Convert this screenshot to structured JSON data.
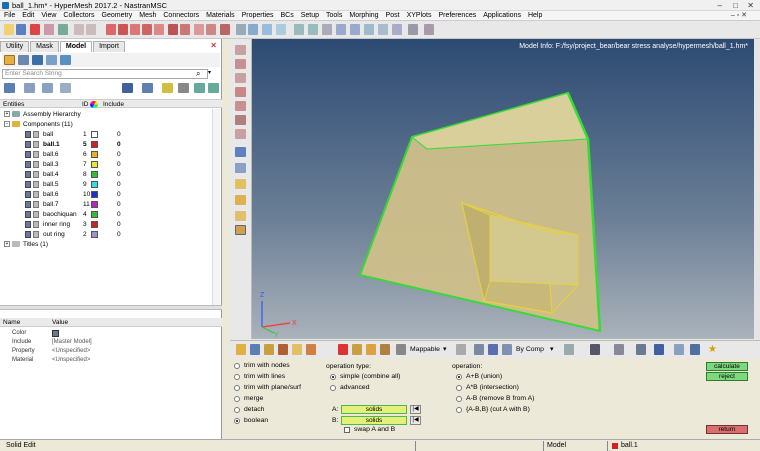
{
  "window": {
    "title": "ball_1.hm* - HyperMesh 2017.2 - NastranMSC"
  },
  "menu": [
    "File",
    "Edit",
    "View",
    "Collectors",
    "Geometry",
    "Mesh",
    "Connectors",
    "Materials",
    "Properties",
    "BCs",
    "Setup",
    "Tools",
    "Morphing",
    "Post",
    "XYPlots",
    "Preferences",
    "Applications",
    "Help"
  ],
  "left_tabs": [
    "Utility",
    "Mask",
    "Model",
    "Import"
  ],
  "search": {
    "placeholder": "Enter Search String"
  },
  "entity_header": {
    "entities": "Entities",
    "id": "ID",
    "include": "Include"
  },
  "tree": {
    "assembly": "Assembly Hierarchy",
    "components": "Components (11)",
    "titles": "Titles (1)"
  },
  "components": [
    {
      "name": "ball",
      "id": "1",
      "color": "#ffffff",
      "include": "0"
    },
    {
      "name": "ball.1",
      "id": "5",
      "color": "#d42020",
      "include": "0"
    },
    {
      "name": "ball.6",
      "id": "6",
      "color": "#e8b020",
      "include": "0"
    },
    {
      "name": "ball.3",
      "id": "7",
      "color": "#e8e830",
      "include": "0"
    },
    {
      "name": "ball.4",
      "id": "8",
      "color": "#30c030",
      "include": "0"
    },
    {
      "name": "ball.5",
      "id": "9",
      "color": "#30e0e0",
      "include": "0"
    },
    {
      "name": "ball.6",
      "id": "10",
      "color": "#2030d0",
      "include": "0"
    },
    {
      "name": "ball.7",
      "id": "11",
      "color": "#c020c0",
      "include": "0"
    },
    {
      "name": "baochiquan",
      "id": "4",
      "color": "#30c030",
      "include": "0"
    },
    {
      "name": "inner ring",
      "id": "3",
      "color": "#d42020",
      "include": "0"
    },
    {
      "name": "out ring",
      "id": "2",
      "color": "#a090d0",
      "include": "0"
    }
  ],
  "prop_header": {
    "name": "Name",
    "value": "Value"
  },
  "properties": [
    {
      "key": "Color",
      "value": ""
    },
    {
      "key": "Include",
      "value": "[Master Model]"
    },
    {
      "key": "Property",
      "value": "<Unspecified>"
    },
    {
      "key": "Material",
      "value": "<Unspecified>"
    }
  ],
  "viewport": {
    "model_info": "Model Info: F:/fsy/project_bear/bear stress analyse/hypermesh/ball_1.hm*"
  },
  "bottom_toolbar": {
    "mappable": "Mappable",
    "by_comp": "By Comp"
  },
  "panel": {
    "modes": [
      {
        "label": "trim with nodes",
        "on": false
      },
      {
        "label": "trim with lines",
        "on": false
      },
      {
        "label": "trim with plane/surf",
        "on": false
      },
      {
        "label": "merge",
        "on": false
      },
      {
        "label": "detach",
        "on": false
      },
      {
        "label": "boolean",
        "on": true
      }
    ],
    "operation_type_title": "operation type:",
    "operation_types": [
      {
        "label": "simple (combine all)",
        "on": true
      },
      {
        "label": "advanced",
        "on": false
      }
    ],
    "a_label": "A:",
    "b_label": "B:",
    "solids_a": "solids",
    "solids_b": "solids",
    "swap": "swap A and B",
    "operation_title": "operation:",
    "operations": [
      {
        "label": "A+B (union)",
        "on": true
      },
      {
        "label": "A*B (intersection)",
        "on": false
      },
      {
        "label": "A-B (remove B from A)",
        "on": false
      },
      {
        "label": "{A-B,B} (cut A with B)",
        "on": false
      }
    ],
    "calculate": "calculate",
    "reject": "reject",
    "return": "return"
  },
  "status": {
    "left": "Solid Edit",
    "model": "Model",
    "component": "ball.1"
  },
  "colors": {
    "accent_green": "#7ed87e",
    "solids_yellow": "#e5f07a",
    "edge_green": "#33dd33",
    "solid_fill": "#cfc08a"
  }
}
